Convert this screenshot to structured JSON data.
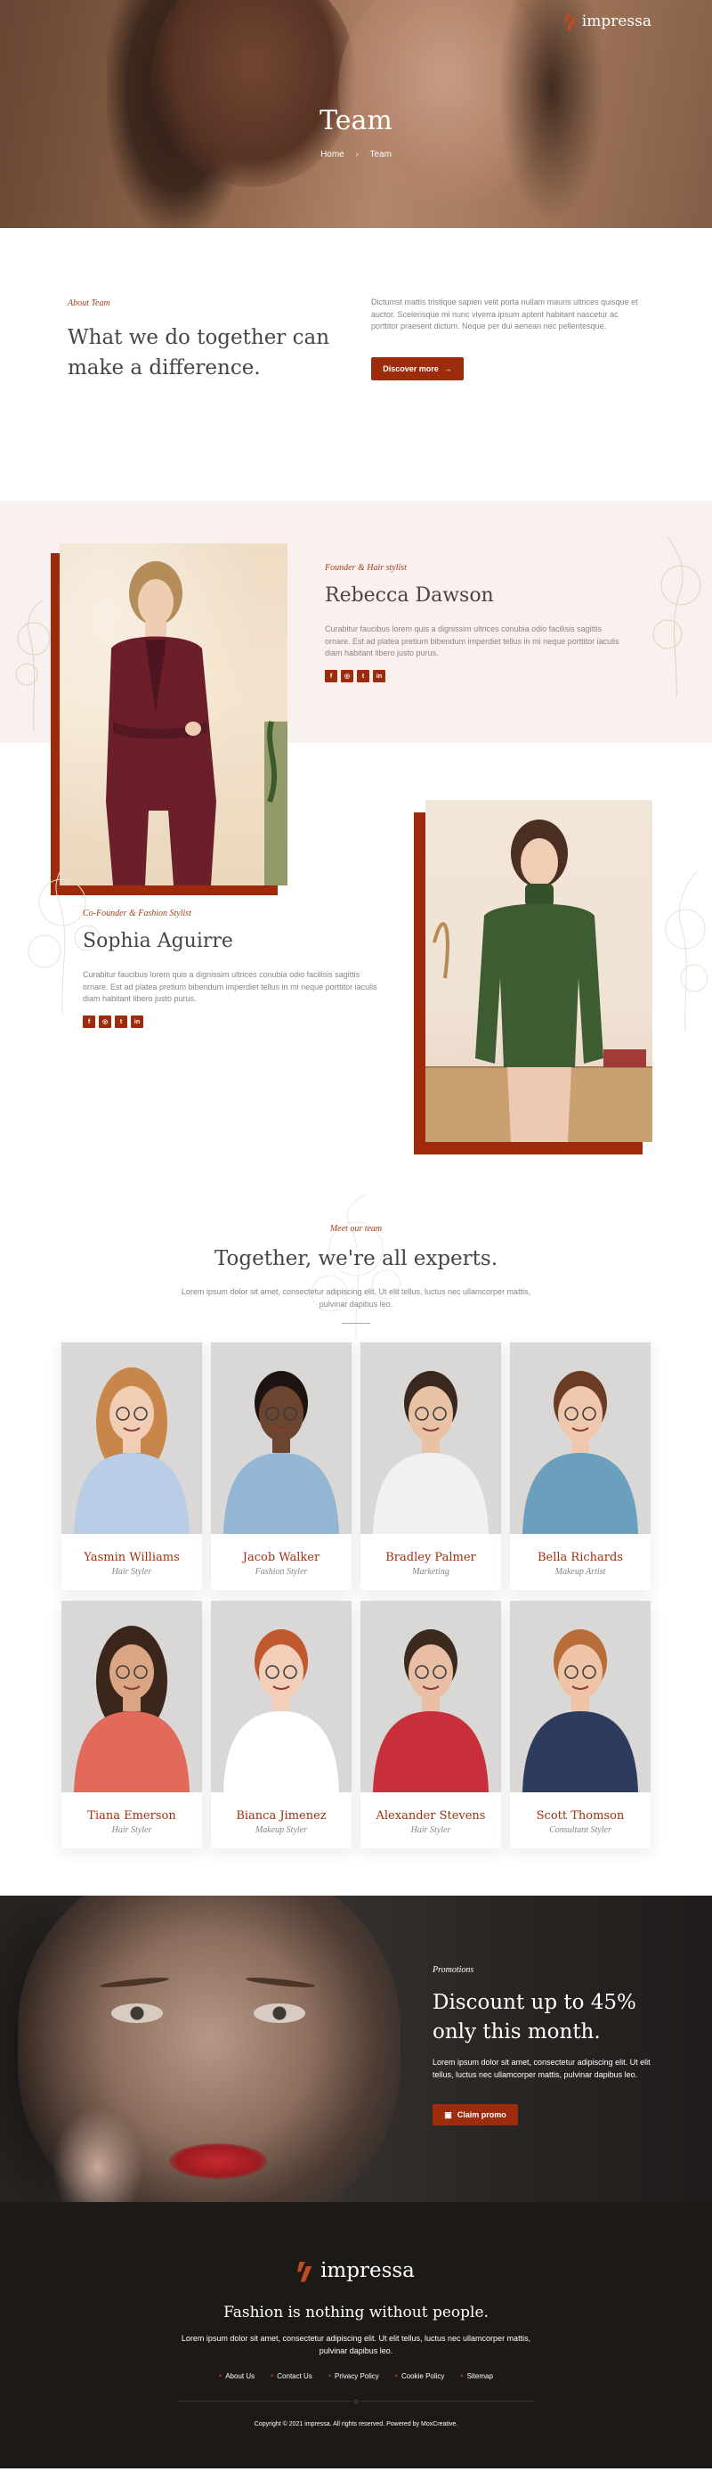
{
  "brand": {
    "name": "impressa",
    "accent": "#9c2c0c"
  },
  "hero": {
    "title": "Team",
    "breadcrumb": {
      "home": "Home",
      "separator": "›",
      "current": "Team"
    }
  },
  "about": {
    "eyebrow": "About Team",
    "heading": "What we do together can make a difference.",
    "text": "Dictumst mattis tristique sapien velit porta nullam mauris ultrices quisque et auctor. Scelerisque mi nunc viverra ipsum aptent habitant nascetur ac porttitor praesent dictum. Neque per dui aenean nec pellentesque.",
    "button": "Discover more",
    "button_icon": "→"
  },
  "founder": {
    "role": "Founder & Hair stylist",
    "name": "Rebecca Dawson",
    "bio": "Curabitur faucibus lorem quis a dignissim ultrices conubia odio facilisis sagittis ornare. Est ad platea pretium bibendum imperdiet tellus in mi neque porttitor iaculis diam habitant libero justo purus.",
    "socials": [
      "f",
      "◎",
      "t",
      "in"
    ]
  },
  "cofounder": {
    "role": "Co-Founder & Fashion Stylist",
    "name": "Sophia Aguirre",
    "bio": "Curabitur faucibus lorem quis a dignissim ultrices conubia odio facilisis sagittis ornare. Est ad platea pretium bibendum imperdiet tellus in mi neque porttitor iaculis diam habitant libero justo purus.",
    "socials": [
      "f",
      "◎",
      "t",
      "in"
    ]
  },
  "team": {
    "eyebrow": "Meet our team",
    "heading": "Together, we're all experts.",
    "lead": "Lorem ipsum dolor sit amet, consectetur adipiscing elit. Ut elit tellus, luctus nec ullamcorper mattis, pulvinar dapibus leo.",
    "members": [
      {
        "name": "Yasmin Williams",
        "role": "Hair Styler"
      },
      {
        "name": "Jacob Walker",
        "role": "Fashion Styler"
      },
      {
        "name": "Bradley Palmer",
        "role": "Marketing"
      },
      {
        "name": "Bella Richards",
        "role": "Makeup Artist"
      },
      {
        "name": "Tiana Emerson",
        "role": "Hair Styler"
      },
      {
        "name": "Bianca Jimenez",
        "role": "Makeup Styler"
      },
      {
        "name": "Alexander Stevens",
        "role": "Hair Styler"
      },
      {
        "name": "Scott Thomson",
        "role": "Consultant Styler"
      }
    ]
  },
  "promo": {
    "eyebrow": "Promotions",
    "heading": "Discount up to 45% only this month.",
    "text": "Lorem ipsum dolor sit amet, consectetur adipiscing elit. Ut elit tellus, luctus nec ullamcorper mattis, pulvinar dapibus leo.",
    "button": "Claim promo",
    "button_icon": "▣"
  },
  "footer": {
    "tagline": "Fashion is nothing without people.",
    "lead": "Lorem ipsum dolor sit amet, consectetur adipiscing elit. Ut elit tellus, luctus nec ullamcorper mattis, pulvinar dapibus leo.",
    "links": [
      "About Us",
      "Contact Us",
      "Privacy Policy",
      "Cookie Policy",
      "Sitemap"
    ],
    "copyright": "Copyright © 2021 impressa. All rights reserved. Powered by MoxCreative."
  }
}
